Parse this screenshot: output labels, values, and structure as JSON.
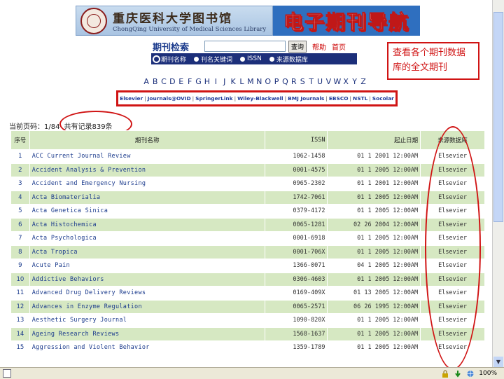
{
  "banner": {
    "library_cn": "重庆医科大学图书馆",
    "library_en": "ChongQing University of Medical Sciences Library",
    "title": "电子期刊导航"
  },
  "search": {
    "heading": "期刊检索",
    "input_value": "",
    "button": "查询",
    "help": "帮助",
    "home": "首页",
    "options": [
      "期刊名称",
      "刊名关键词",
      "ISSN",
      "来源数据库"
    ],
    "selected_option": 0
  },
  "callout": {
    "text": "查看各个期刊数据库的全文期刊"
  },
  "alphabet": [
    "A",
    "B",
    "C",
    "D",
    "E",
    "F",
    "G",
    "H",
    "I",
    "J",
    "K",
    "L",
    "M",
    "N",
    "O",
    "P",
    "Q",
    "R",
    "S",
    "T",
    "U",
    "V",
    "W",
    "X",
    "Y",
    "Z"
  ],
  "sources": [
    "Elsevier",
    "Journals@OVID",
    "SpringerLink",
    "Wiley-Blackwell",
    "BMJ Journals",
    "EBSCO",
    "NSTL",
    "Socolar"
  ],
  "status": {
    "page": "当前页码：1/84",
    "records": "共有记录839条"
  },
  "table": {
    "headers": [
      "序号",
      "期刊名称",
      "ISSN",
      "起止日期",
      "来源数据库"
    ],
    "rows": [
      [
        "1",
        "ACC Current Journal Review",
        "1062-1458",
        "01 1 2001 12:00AM",
        "Elsevier"
      ],
      [
        "2",
        "Accident Analysis & Prevention",
        "0001-4575",
        "01 1 2005 12:00AM",
        "Elsevier"
      ],
      [
        "3",
        "Accident and Emergency Nursing",
        "0965-2302",
        "01 1 2001 12:00AM",
        "Elsevier"
      ],
      [
        "4",
        "Acta Biomaterialia",
        "1742-7061",
        "01 1 2005 12:00AM",
        "Elsevier"
      ],
      [
        "5",
        "Acta Genetica Sinica",
        "0379-4172",
        "01 1 2005 12:00AM",
        "Elsevier"
      ],
      [
        "6",
        "Acta Histochemica",
        "0065-1281",
        "02 26 2004 12:00AM",
        "Elsevier"
      ],
      [
        "7",
        "Acta Psychologica",
        "0001-6918",
        "01 1 2005 12:00AM",
        "Elsevier"
      ],
      [
        "8",
        "Acta Tropica",
        "0001-706X",
        "01 1 2005 12:00AM",
        "Elsevier"
      ],
      [
        "9",
        "Acute Pain",
        "1366-0071",
        "04 1 2005 12:00AM",
        "Elsevier"
      ],
      [
        "10",
        "Addictive Behaviors",
        "0306-4603",
        "01 1 2005 12:00AM",
        "Elsevier"
      ],
      [
        "11",
        "Advanced Drug Delivery Reviews",
        "0169-409X",
        "01 13 2005 12:00AM",
        "Elsevier"
      ],
      [
        "12",
        "Advances in Enzyme Regulation",
        "0065-2571",
        "06 26 1995 12:00AM",
        "Elsevier"
      ],
      [
        "13",
        "Aesthetic Surgery Journal",
        "1090-820X",
        "01 1 2005 12:00AM",
        "Elsevier"
      ],
      [
        "14",
        "Ageing Research Reviews",
        "1568-1637",
        "01 1 2005 12:00AM",
        "Elsevier"
      ],
      [
        "15",
        "Aggression and Violent Behavior",
        "1359-1789",
        "01 1 2005 12:00AM",
        "Elsevier"
      ]
    ]
  },
  "statusbar": {
    "zoom": "100%"
  },
  "colors": {
    "annotation_red": "#d01414",
    "row_green": "#d6e8c2",
    "link_blue": "#1a3a8c",
    "banner_blue": "#2f6fbf"
  }
}
